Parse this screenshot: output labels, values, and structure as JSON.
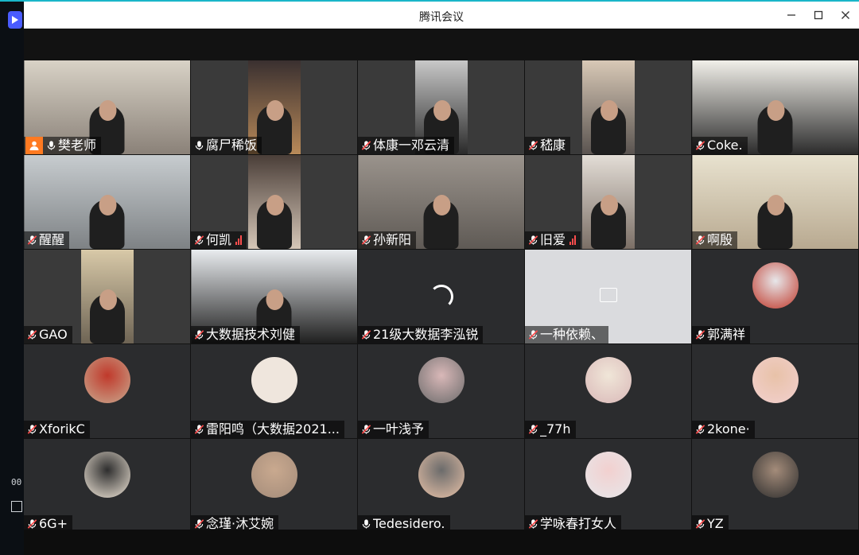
{
  "window": {
    "title": "腾讯会议",
    "controls": [
      "minimize",
      "maximize",
      "close"
    ]
  },
  "desktop": {
    "side_text": "00"
  },
  "participants": [
    {
      "name": "樊老师",
      "host": true,
      "mic": "on",
      "tile": "video"
    },
    {
      "name": "腐尸稀饭",
      "mic": "on",
      "tile": "video"
    },
    {
      "name": "体康一邓云清",
      "mic": "muted",
      "tile": "video"
    },
    {
      "name": "嵇康",
      "mic": "muted",
      "tile": "video"
    },
    {
      "name": "Coke.",
      "mic": "muted",
      "tile": "video"
    },
    {
      "name": "醒醒",
      "mic": "muted",
      "tile": "video"
    },
    {
      "name": "何凯",
      "mic": "muted",
      "signal": "weak",
      "tile": "video"
    },
    {
      "name": "孙新阳",
      "mic": "muted",
      "tile": "video"
    },
    {
      "name": "旧爱",
      "mic": "muted",
      "signal": "weak",
      "tile": "video"
    },
    {
      "name": "啊殷",
      "mic": "muted",
      "tile": "video"
    },
    {
      "name": "GAO",
      "mic": "muted",
      "tile": "video"
    },
    {
      "name": "大数据技术刘健",
      "mic": "muted",
      "tile": "video"
    },
    {
      "name": "21级大数据李泓锐",
      "mic": "muted",
      "tile": "loading"
    },
    {
      "name": "一种依赖、",
      "mic": "muted",
      "tile": "private"
    },
    {
      "name": "郭满祥",
      "mic": "muted",
      "tile": "avatar"
    },
    {
      "name": "XforikC",
      "mic": "muted",
      "tile": "avatar"
    },
    {
      "name": "雷阳鸣（大数据2021...",
      "mic": "muted",
      "tile": "avatar"
    },
    {
      "name": "一叶浅予",
      "mic": "muted",
      "tile": "avatar"
    },
    {
      "name": "_77h",
      "mic": "muted",
      "tile": "avatar"
    },
    {
      "name": "2kone·",
      "mic": "muted",
      "tile": "avatar"
    },
    {
      "name": "6G+",
      "mic": "muted",
      "tile": "avatar"
    },
    {
      "name": "念瑾·沐艾婉",
      "mic": "muted",
      "tile": "avatar"
    },
    {
      "name": "Tedesidero.",
      "mic": "on",
      "tile": "avatar"
    },
    {
      "name": "学咏春打女人",
      "mic": "muted",
      "tile": "avatar"
    },
    {
      "name": "YZ",
      "mic": "muted",
      "tile": "avatar"
    }
  ],
  "colors": {
    "host_badge": "#ff7a21",
    "muted_mic": "#ff4d4d",
    "tile_bg": "#2b2c2e",
    "window_bg": "#121212"
  }
}
